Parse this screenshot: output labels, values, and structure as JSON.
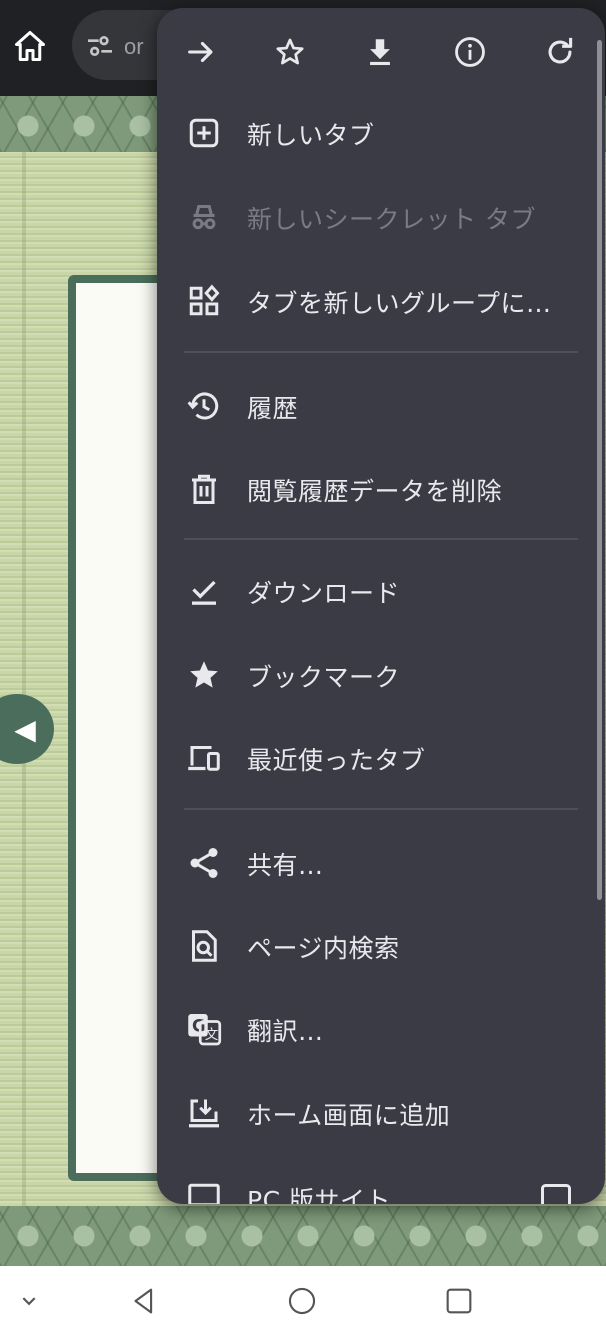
{
  "toolbar": {
    "url_text": "or"
  },
  "menu": {
    "top_icons": [
      "forward-icon",
      "star-outline-icon",
      "download-icon",
      "info-icon",
      "reload-icon"
    ],
    "items": [
      {
        "label": "新しいタブ",
        "icon": "add-box-icon",
        "enabled": true
      },
      {
        "label": "新しいシークレット タブ",
        "icon": "incognito-icon",
        "enabled": false
      },
      {
        "label": "タブを新しいグループに…",
        "icon": "tab-group-icon",
        "enabled": true
      },
      {
        "label": "履歴",
        "icon": "history-icon",
        "enabled": true
      },
      {
        "label": "閲覧履歴データを削除",
        "icon": "trash-icon",
        "enabled": true
      },
      {
        "label": "ダウンロード",
        "icon": "download-done-icon",
        "enabled": true
      },
      {
        "label": "ブックマーク",
        "icon": "star-icon",
        "enabled": true
      },
      {
        "label": "最近使ったタブ",
        "icon": "devices-icon",
        "enabled": true
      },
      {
        "label": "共有…",
        "icon": "share-icon",
        "enabled": true
      },
      {
        "label": "ページ内検索",
        "icon": "find-in-page-icon",
        "enabled": true
      },
      {
        "label": "翻訳…",
        "icon": "translate-icon",
        "enabled": true
      },
      {
        "label": "ホーム画面に追加",
        "icon": "add-to-home-icon",
        "enabled": true
      },
      {
        "label": "PC 版サイト",
        "icon": "desktop-icon",
        "enabled": true
      }
    ]
  },
  "colors": {
    "menu_bg": "#3b3b45",
    "toolbar_bg": "#202124",
    "tatami": "#c5d3a1",
    "panel_border": "#4b6e5c"
  }
}
